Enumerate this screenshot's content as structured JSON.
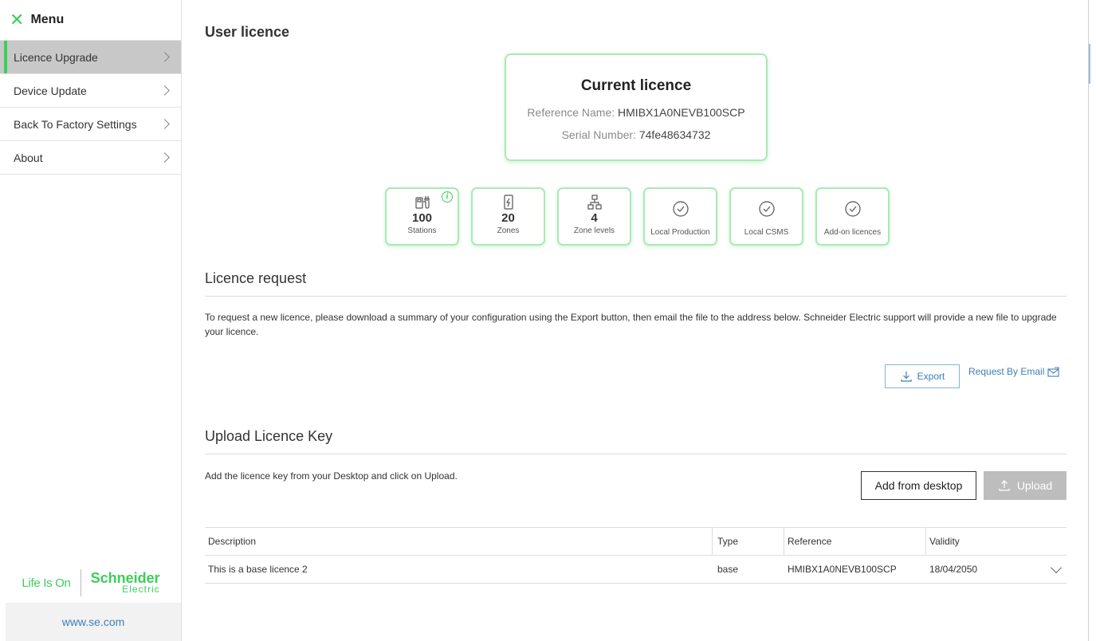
{
  "menu": {
    "title": "Menu"
  },
  "sidebar": {
    "items": [
      {
        "label": "Licence Upgrade"
      },
      {
        "label": "Device Update"
      },
      {
        "label": "Back To Factory Settings"
      },
      {
        "label": "About"
      }
    ],
    "brand": {
      "tagline": "Life Is On",
      "company": "Schneider",
      "company_sub": "Electric"
    },
    "website": "www.se.com"
  },
  "page": {
    "title": "User licence"
  },
  "current_licence": {
    "title": "Current licence",
    "reference_label": "Reference Name:",
    "reference_value": "HMIBX1A0NEVB100SCP",
    "serial_label": "Serial Number:",
    "serial_value": "74fe48634732"
  },
  "features": [
    {
      "icon": "stations-icon",
      "value": "100",
      "label": "Stations"
    },
    {
      "icon": "zones-icon",
      "value": "20",
      "label": "Zones"
    },
    {
      "icon": "zone-levels-icon",
      "value": "4",
      "label": "Zone levels"
    },
    {
      "icon": "check-circle-icon",
      "label": "Local Production"
    },
    {
      "icon": "check-circle-icon",
      "label": "Local CSMS"
    },
    {
      "icon": "check-circle-icon",
      "label": "Add-on licences"
    }
  ],
  "licence_request": {
    "title": "Licence request",
    "text": "To request a new licence, please download a summary of your configuration using the Export button, then email the file to the address below. Schneider Electric support will provide a new file to upgrade your licence.",
    "export_label": "Export",
    "email_label": "Request By Email"
  },
  "upload": {
    "title": "Upload Licence Key",
    "text": "Add the licence key from your Desktop and click on Upload.",
    "add_label": "Add from desktop",
    "upload_label": "Upload"
  },
  "table": {
    "headers": [
      "Description",
      "Type",
      "Reference",
      "Validity"
    ],
    "rows": [
      {
        "description": "This is a base licence 2",
        "type": "base",
        "reference": "HMIBX1A0NEVB100SCP",
        "validity": "18/04/2050"
      }
    ]
  },
  "colors": {
    "accent": "#3dcd58",
    "link": "#3d7fb8"
  }
}
